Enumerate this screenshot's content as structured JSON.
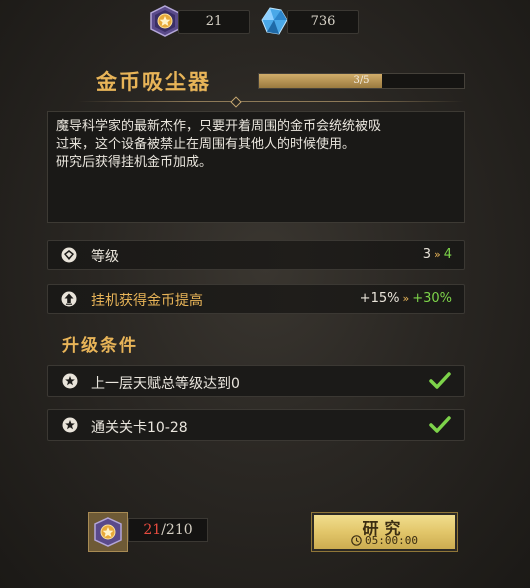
{
  "resources": {
    "medal": {
      "icon": "medal-icon",
      "value": "21"
    },
    "crystal": {
      "icon": "crystal-icon",
      "value": "736"
    }
  },
  "item": {
    "title": "金币吸尘器",
    "progress_text": "3/5",
    "progress_fraction": 0.6,
    "description_lines": [
      "魔导科学家的最新杰作，只要开着周围的金币会统统被吸",
      "过来，这个设备被禁止在周围有其他人的时候使用。",
      "研究后获得挂机金币加成。"
    ]
  },
  "stats": {
    "level": {
      "label": "等级",
      "from": "3",
      "to": "4"
    },
    "bonus": {
      "label": "挂机获得金币提高",
      "from": "+15%",
      "to": "+30%"
    }
  },
  "requirements": {
    "title": "升级条件",
    "items": [
      {
        "label": "上一层天赋总等级达到0",
        "met": true
      },
      {
        "label": "通关关卡10-28",
        "met": true
      }
    ]
  },
  "cost": {
    "have": "21",
    "separator": "/",
    "need": "210"
  },
  "research_button": {
    "label": "研究",
    "time": "05:00:00"
  },
  "colors": {
    "accent_gold": "#e8b458",
    "green_check": "#7dd34a",
    "insufficient_red": "#e54b3f"
  }
}
